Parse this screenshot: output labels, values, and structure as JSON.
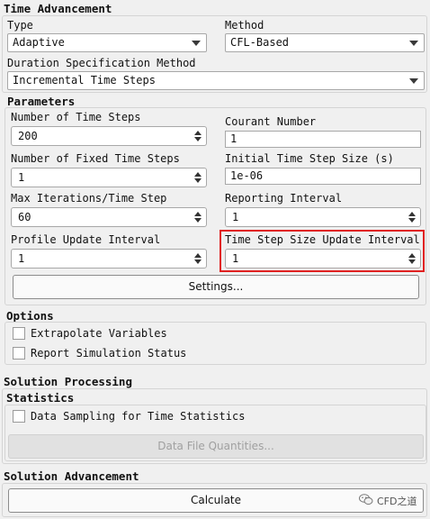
{
  "time_advancement": {
    "title": "Time Advancement",
    "type_label": "Type",
    "type_value": "Adaptive",
    "method_label": "Method",
    "method_value": "CFL-Based",
    "duration_label": "Duration Specification Method",
    "duration_value": "Incremental Time Steps"
  },
  "parameters": {
    "title": "Parameters",
    "num_time_steps_label": "Number of Time Steps",
    "num_time_steps_value": "200",
    "courant_label": "Courant Number",
    "courant_value": "1",
    "num_fixed_steps_label": "Number of Fixed Time Steps",
    "num_fixed_steps_value": "1",
    "initial_step_label": "Initial Time Step Size (s)",
    "initial_step_value": "1e-06",
    "max_iter_label": "Max Iterations/Time Step",
    "max_iter_value": "60",
    "reporting_label": "Reporting Interval",
    "reporting_value": "1",
    "profile_label": "Profile Update Interval",
    "profile_value": "1",
    "step_update_label": "Time Step Size Update Interval",
    "step_update_value": "1",
    "settings_button": "Settings..."
  },
  "options": {
    "title": "Options",
    "extrapolate_label": "Extrapolate Variables",
    "extrapolate_checked": false,
    "report_label": "Report Simulation Status",
    "report_checked": false
  },
  "solution_processing": {
    "title": "Solution Processing",
    "statistics_title": "Statistics",
    "sampling_label": "Data Sampling for Time Statistics",
    "sampling_checked": false,
    "data_file_button": "Data File Quantities..."
  },
  "solution_advancement": {
    "title": "Solution Advancement",
    "calculate_button": "Calculate"
  },
  "watermark": {
    "text": "CFD之道",
    "icon": "wechat-icon"
  },
  "colors": {
    "highlight": "#e02020",
    "background": "#f0f0f0"
  }
}
